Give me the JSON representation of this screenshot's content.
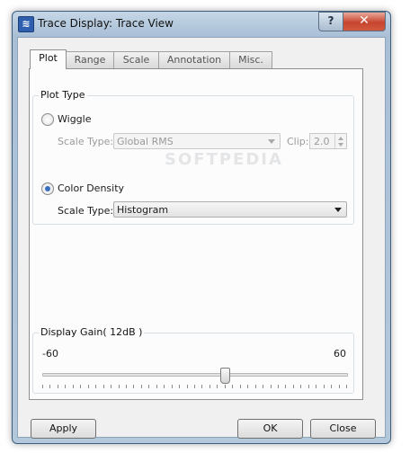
{
  "window": {
    "title": "Trace Display: Trace View",
    "help_glyph": "?",
    "close_glyph": "✕"
  },
  "tabs": [
    {
      "label": "Plot",
      "active": true
    },
    {
      "label": "Range",
      "active": false
    },
    {
      "label": "Scale",
      "active": false
    },
    {
      "label": "Annotation",
      "active": false
    },
    {
      "label": "Misc.",
      "active": false
    }
  ],
  "plot_type": {
    "group_label": "Plot Type",
    "wiggle": {
      "label": "Wiggle",
      "selected": false,
      "scale_type_label": "Scale Type:",
      "scale_type_value": "Global RMS",
      "clip_label": "Clip:",
      "clip_value": "2.0"
    },
    "color_density": {
      "label": "Color Density",
      "selected": true,
      "scale_type_label": "Scale Type:",
      "scale_type_value": "Histogram"
    }
  },
  "display_gain": {
    "group_label": "Display Gain( 12dB )",
    "min_label": "-60",
    "max_label": "60",
    "min": -60,
    "max": 60,
    "value": 12
  },
  "buttons": {
    "apply": "Apply",
    "ok": "OK",
    "close": "Close"
  }
}
